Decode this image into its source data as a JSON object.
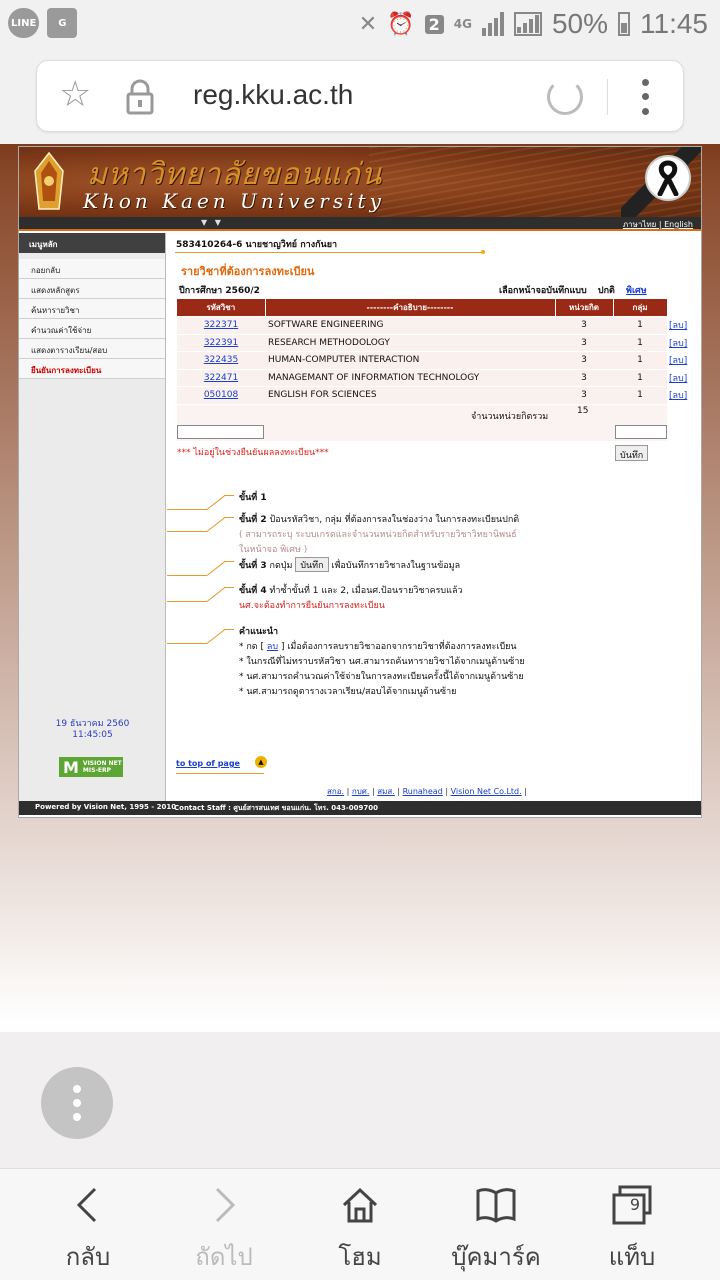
{
  "status_bar": {
    "left_icons": [
      "line-app-icon",
      "maps-app-icon"
    ],
    "sim": "2",
    "network": "4G",
    "battery": "50%",
    "time": "11:45"
  },
  "browser": {
    "url": "reg.kku.ac.th"
  },
  "site": {
    "banner_thai": "มหาวิทยาลัยขอนแก่น",
    "banner_en": "Khon Kaen University",
    "lang_thai": "ภาษาไทย",
    "lang_sep": " | ",
    "lang_en": "English",
    "menu_title": "เมนูหลัก",
    "menu_items": [
      "กอยกลับ",
      "แสดงหลักสูตร",
      "ค้นหารายวิชา",
      "คำนวณค่าใช้จ่าย",
      "แสดงตารางเรียน/สอบ",
      "ยืนยันการลงทะเบียน"
    ],
    "date_line1": "19 ธันวาคม 2560",
    "date_line2": "11:45:05",
    "mis_logo": "VISION NET MIS-ERP",
    "student": "583410264-6 นายชาญวิทย์ กางกันยา",
    "section_title": "รายวิชาที่ต้องการลงทะเบียน",
    "year": "ปีการศึกษา 2560/2",
    "mode_label": "เลือกหน้าจอบันทึกแบบ",
    "mode_normal": "ปกติ",
    "mode_special": "พิเศษ",
    "table_headers": [
      "รหัสวิชา",
      "--------คำอธิบาย--------",
      "หน่วยกิต",
      "กลุ่ม"
    ],
    "courses": [
      {
        "code": "322371",
        "name": "SOFTWARE ENGINEERING",
        "credit": "3",
        "group": "1",
        "del": "[ลบ]"
      },
      {
        "code": "322391",
        "name": "RESEARCH METHODOLOGY",
        "credit": "3",
        "group": "1",
        "del": "[ลบ]"
      },
      {
        "code": "322435",
        "name": "HUMAN-COMPUTER INTERACTION",
        "credit": "3",
        "group": "1",
        "del": "[ลบ]"
      },
      {
        "code": "322471",
        "name": "MANAGEMANT OF INFORMATION TECHNOLOGY",
        "credit": "3",
        "group": "1",
        "del": "[ลบ]"
      },
      {
        "code": "050108",
        "name": "ENGLISH FOR SCIENCES",
        "credit": "3",
        "group": "1",
        "del": "[ลบ]"
      }
    ],
    "total_label": "จำนวนหน่วยกิตรวม",
    "total_value": "15",
    "warning": "*** ไม่อยู่ในช่วงยืนยันผลลงทะเบียน***",
    "save_label": "บันทึก",
    "step1": "ขั้นที่ 1",
    "step2_head": "ขั้นที่ 2",
    "step2_text": " ป้อนรหัสวิชา, กลุ่ม ที่ต้องการลงในช่องว่าง ในการลงทะเบียนปกติ",
    "step2_note1": "( สามารถระบุ ระบบเกรดและจำนวนหน่วยกิตสำหรับรายวิชาวิทยานิพนธ์",
    "step2_note2": "ในหน้าจอ พิเศษ )",
    "step3_head": "ขั้นที่ 3",
    "step3_pre": " กดปุ่ม ",
    "step3_btn": "บันทึก",
    "step3_post": " เพื่อบันทึกรายวิชาลงในฐานข้อมูล",
    "step4_head": "ขั้นที่ 4",
    "step4_text": " ทำซ้ำขั้นที่ 1 และ 2, เมื่อนศ.ป้อนรายวิชาครบแล้ว",
    "step4_red": "นศ.จะต้องทำการยืนยันการลงทะเบียน",
    "advice_head": "คำแนะนำ",
    "advice1_pre": "* กด [ ",
    "advice1_link": "ลบ",
    "advice1_post": " ] เมื่อต้องการลบรายวิชาออกจากรายวิชาที่ต้องการลงทะเบียน",
    "advice2": "* ในกรณีที่ไม่ทราบรหัสวิชา นศ.สามารถค้นหารายวิชาได้จากเมนูด้านซ้าย",
    "advice3": "* นศ.สามารถคำนวณค่าใช้จ่ายในการลงทะเบียนครั้งนี้ได้จากเมนูด้านซ้าย",
    "advice4": "* นศ.สามารถดูตารางเวลาเรียน/สอบได้จากเมนูด้านซ้าย",
    "to_top": "to top of page",
    "footer_links": [
      "สกอ.",
      "กบศ.",
      "สมส.",
      "Runahead",
      "Vision Net Co.Ltd."
    ],
    "powered": "Powered by Vision Net, 1995 - 2010",
    "contact": "Contact Staff : ศูนย์สารสนเทศ ขอนแก่น. โทร. 043-009700"
  },
  "bottom_nav": [
    {
      "label": "กลับ",
      "icon": "back-arrow-icon",
      "enabled": true
    },
    {
      "label": "ถัดไป",
      "icon": "forward-arrow-icon",
      "enabled": false
    },
    {
      "label": "โฮม",
      "icon": "home-icon",
      "enabled": true
    },
    {
      "label": "บุ๊คมาร์ค",
      "icon": "bookmark-icon",
      "enabled": true
    },
    {
      "label": "แท็บ",
      "icon": "tabs-icon",
      "enabled": true,
      "count": "9"
    }
  ]
}
